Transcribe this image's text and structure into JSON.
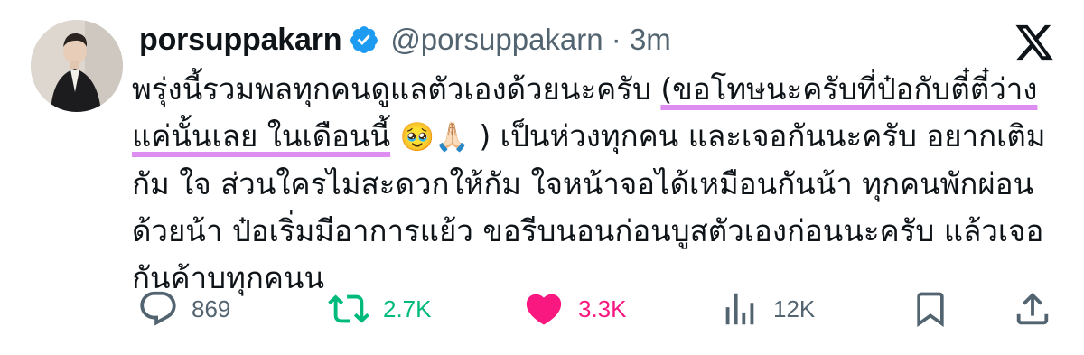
{
  "user": {
    "display_name": "porsuppakarn",
    "handle": "@porsuppakarn · 3m"
  },
  "tweet": {
    "line1_plain": "พรุ่งนี้รวมพลทุกคนดูแลตัวเองด้วยนะครับ ",
    "line1_hl": "(ขอโทษนะครับที่ป๋อกับตี๋ตี๋ว่าง",
    "line2_hl": "แค่นั้นเลย ในเดือนนี้",
    "emoji_1": "🥹",
    "emoji_2": "🙏🏻",
    "line2_plain": " ) เป็นห่วงทุกคน และเจอกันนะครับ อยากเติม",
    "line3": "กัม ใจ ส่วนใครไม่สะดวกให้กัม ใจหน้าจอได้เหมือนกันน้า ทุกคนพักผ่อน",
    "line4": "ด้วยน้า ป๋อเริ่มมีอาการแย้ว ขอรีบนอนก่อนบูสตัวเองก่อนนะครับ แล้วเจอ",
    "line5": "กันค้าบทุกคนน"
  },
  "actions": {
    "replies": "869",
    "reposts": "2.7K",
    "likes": "3.3K",
    "views": "12K"
  },
  "icons": {
    "verified": "verified-badge-icon",
    "platform": "x-logo-icon",
    "reply": "reply-icon",
    "repost": "repost-icon",
    "like": "heart-icon",
    "views": "views-icon",
    "bookmark": "bookmark-icon",
    "share": "share-icon"
  },
  "colors": {
    "highlight": "#dd8ef0",
    "verified": "#1d9bf0",
    "repost": "#00ba7c",
    "like": "#f91880",
    "muted": "#536471"
  }
}
